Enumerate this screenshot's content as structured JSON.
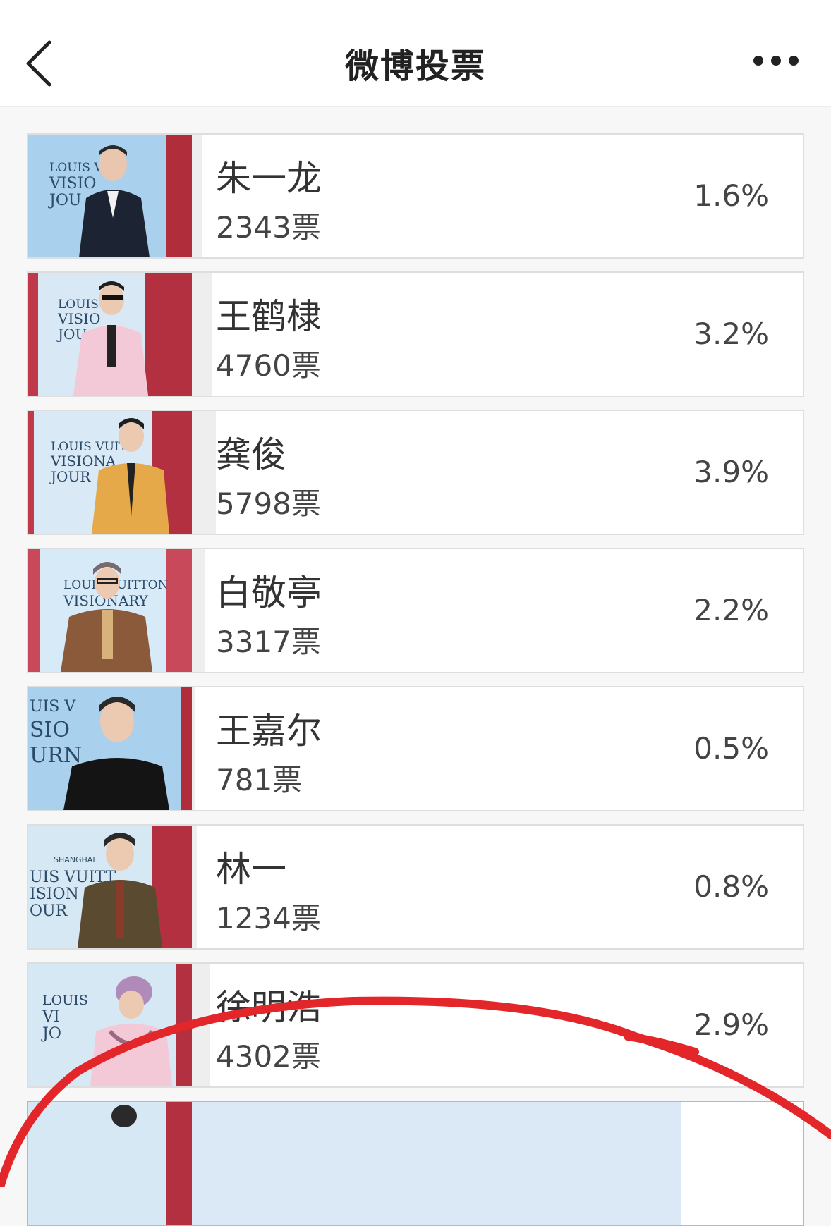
{
  "header": {
    "title": "微博投票",
    "back_icon": "chevron-left-icon",
    "more_icon": "more-dots-icon"
  },
  "accent": {
    "annotation_stroke": "#e3262a",
    "bar_fill": "#eeeeee",
    "featured_fill": "#dbe8f6"
  },
  "options": [
    {
      "name": "朱一龙",
      "votes": "2343票",
      "percent": "1.6%",
      "percent_value": 1.6
    },
    {
      "name": "王鹤棣",
      "votes": "4760票",
      "percent": "3.2%",
      "percent_value": 3.2
    },
    {
      "name": "龚俊",
      "votes": "5798票",
      "percent": "3.9%",
      "percent_value": 3.9
    },
    {
      "name": "白敬亭",
      "votes": "3317票",
      "percent": "2.2%",
      "percent_value": 2.2
    },
    {
      "name": "王嘉尔",
      "votes": "781票",
      "percent": "0.5%",
      "percent_value": 0.5
    },
    {
      "name": "林一",
      "votes": "1234票",
      "percent": "0.8%",
      "percent_value": 0.8
    },
    {
      "name": "徐明浩",
      "votes": "4302票",
      "percent": "2.9%",
      "percent_value": 2.9
    },
    {
      "name": "",
      "votes": "",
      "percent": "",
      "percent_value": 80
    }
  ]
}
